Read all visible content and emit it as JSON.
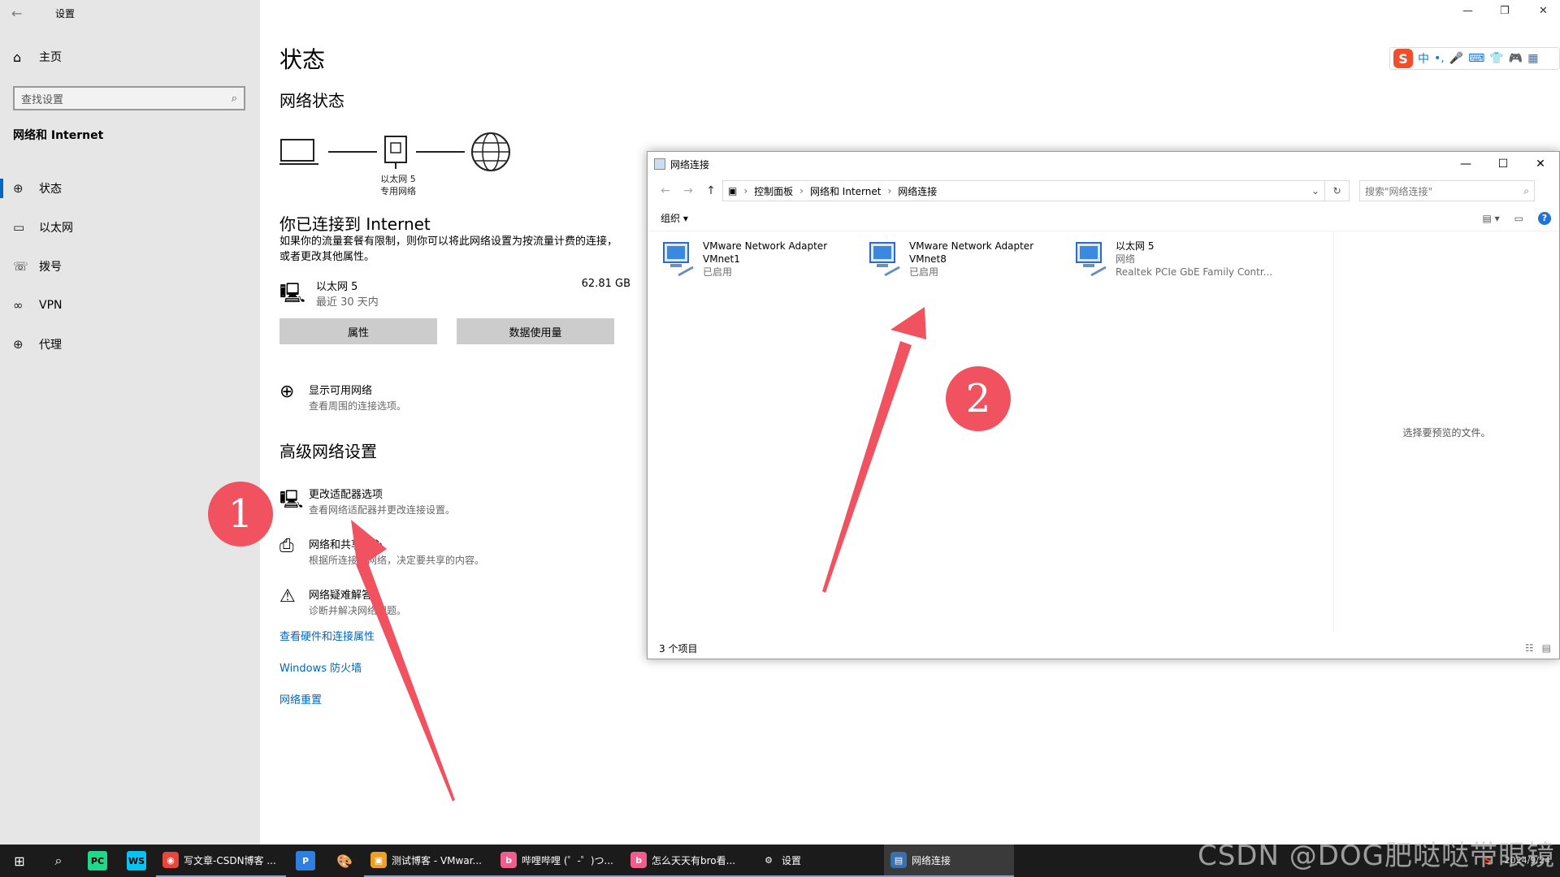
{
  "settings": {
    "app_title": "设置",
    "home": "主页",
    "search_placeholder": "查找设置",
    "section": "网络和 Internet",
    "nav": [
      {
        "label": "状态",
        "icon": "globe-status-icon"
      },
      {
        "label": "以太网",
        "icon": "ethernet-icon"
      },
      {
        "label": "拨号",
        "icon": "dialup-icon"
      },
      {
        "label": "VPN",
        "icon": "vpn-icon"
      },
      {
        "label": "代理",
        "icon": "proxy-globe-icon"
      }
    ]
  },
  "main": {
    "title": "状态",
    "network_status": "网络状态",
    "adapter_label": "以太网 5",
    "adapter_sublabel": "专用网络",
    "connected_heading": "你已连接到 Internet",
    "connected_desc": "如果你的流量套餐有限制，则你可以将此网络设置为按流量计费的连接，或者更改其他属性。",
    "ethernet": {
      "name": "以太网 5",
      "period": "最近 30 天内",
      "usage": "62.81 GB"
    },
    "buttons": {
      "properties": "属性",
      "data_usage": "数据使用量"
    },
    "show_networks": {
      "title": "显示可用网络",
      "desc": "查看周围的连接选项。"
    },
    "advanced_heading": "高级网络设置",
    "advanced_items": [
      {
        "title": "更改适配器选项",
        "desc": "查看网络适配器并更改连接设置。"
      },
      {
        "title": "网络和共享中心",
        "desc": "根据所连接的网络，决定要共享的内容。"
      },
      {
        "title": "网络疑难解答",
        "desc": "诊断并解决网络问题。"
      }
    ],
    "links": [
      "查看硬件和连接属性",
      "Windows 防火墙",
      "网络重置"
    ]
  },
  "explorer": {
    "title": "网络连接",
    "breadcrumb": [
      "控制面板",
      "网络和 Internet",
      "网络连接"
    ],
    "search_placeholder": "搜索\"网络连接\"",
    "organize": "组织 ▾",
    "items": [
      {
        "line1": "VMware Network Adapter",
        "line2": "VMnet1",
        "line3": "已启用"
      },
      {
        "line1": "VMware Network Adapter",
        "line2": "VMnet8",
        "line3": "已启用"
      },
      {
        "line1": "以太网 5",
        "line2": "网络",
        "line3": "Realtek PCIe GbE Family Contr..."
      }
    ],
    "preview_text": "选择要预览的文件。",
    "status": "3 个项目"
  },
  "annotations": {
    "badge1": "1",
    "badge2": "2",
    "color": "#f05260"
  },
  "ime": {
    "label": "中"
  },
  "taskbar": {
    "apps": [
      {
        "label": "写文章-CSDN博客 ...",
        "color": "#e8453c",
        "icon": "chrome-icon"
      },
      {
        "label": "测试博客 - VMwar...",
        "color": "#f0a020",
        "icon": "vmware-icon"
      },
      {
        "label": "哔哩哔哩 (゜-゜)つ...",
        "color": "#f25d8e",
        "icon": "bilibili-icon"
      },
      {
        "label": "怎么天天有bro看...",
        "color": "#f25d8e",
        "icon": "bilibili-icon"
      },
      {
        "label": "设置",
        "color": "#1b1b1b",
        "icon": "gear-icon"
      },
      {
        "label": "网络连接",
        "color": "#3a6fb0",
        "icon": "network-folder-icon"
      }
    ],
    "date": "2024/9/24"
  },
  "watermark": "CSDN @DOG肥哒哒带眼镜"
}
